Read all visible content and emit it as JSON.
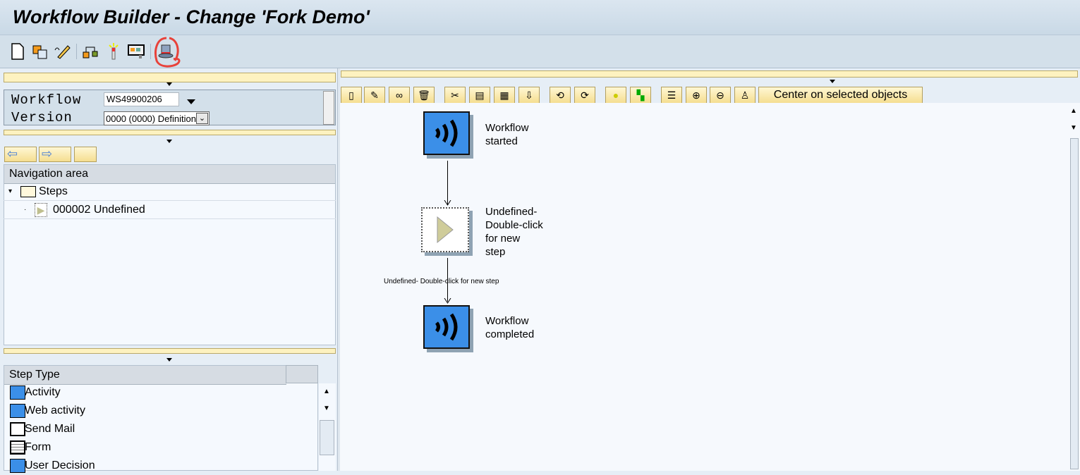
{
  "window": {
    "title": "Workflow Builder - Change 'Fork Demo'"
  },
  "toolbar": {
    "items": [
      "new-document",
      "copy-objects",
      "change-pencil",
      "workflow-structure",
      "wizard",
      "screen-display",
      "basic-data-hat"
    ]
  },
  "form": {
    "workflow_label": "Workflow",
    "workflow_value": "WS49900206",
    "version_label": "Version",
    "version_value": "0000 (0000) Definition"
  },
  "navigation": {
    "header": "Navigation area",
    "folder": "Steps",
    "items": [
      {
        "label": "000002 Undefined"
      }
    ]
  },
  "step_types": {
    "header": "Step Type",
    "items": [
      {
        "label": "Activity"
      },
      {
        "label": "Web activity"
      },
      {
        "label": "Send Mail"
      },
      {
        "label": "Form"
      },
      {
        "label": "User Decision"
      }
    ]
  },
  "graphic_toolbar": {
    "center_label": "Center on selected objects"
  },
  "diagram": {
    "nodes": [
      {
        "label1": "Workflow",
        "label2": "started"
      },
      {
        "label1": "Undefined-",
        "label2": "Double-click",
        "label3": "for new",
        "label4": "step"
      },
      {
        "label1": "Workflow",
        "label2": "completed"
      }
    ],
    "edge_label": "Undefined- Double-click for new step"
  },
  "colors": {
    "event_node": "#3b8fe8",
    "annotation": "#e8423a"
  }
}
